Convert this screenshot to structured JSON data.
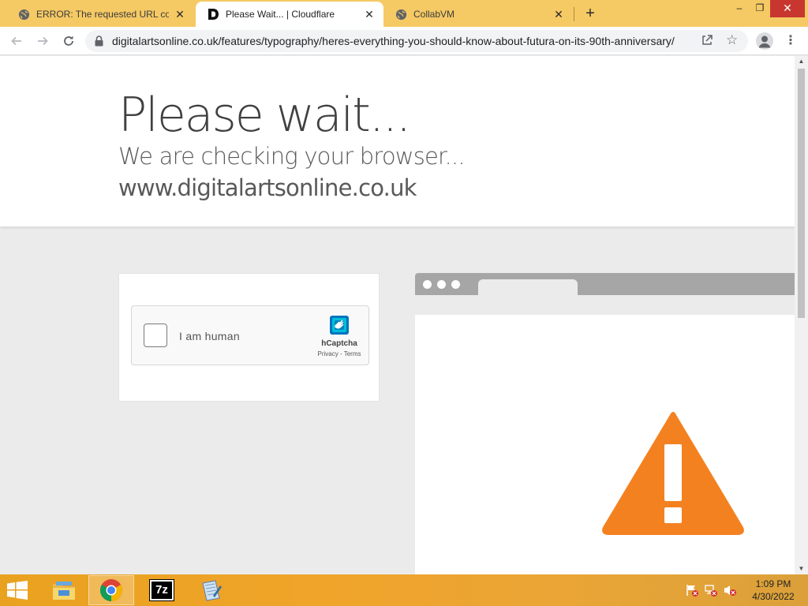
{
  "browser": {
    "tabs": [
      {
        "title": "ERROR: The requested URL could not be retrieved",
        "favicon": "globe-icon",
        "active": false
      },
      {
        "title": "Please Wait... | Cloudflare",
        "favicon": "digitalarts-d-icon",
        "active": true
      },
      {
        "title": "CollabVM",
        "favicon": "globe-icon",
        "active": false
      }
    ],
    "url": "digitalartsonline.co.uk/features/typography/heres-everything-you-should-know-about-futura-on-its-90th-anniversary/",
    "tab_close_glyph": "✕",
    "new_tab_glyph": "+",
    "window_controls": {
      "minimize": "–",
      "restore": "❐",
      "close": "✕"
    }
  },
  "page": {
    "headline": "Please wait...",
    "subline": "We are checking your browser...",
    "domain": "www.digitalartsonline.co.uk"
  },
  "captcha": {
    "label": "I am human",
    "brand": "hCaptcha",
    "links": "Privacy - Terms"
  },
  "colors": {
    "tab_strip": "#f5c964",
    "warning": "#f48120",
    "taskbar": "#f0a42a"
  },
  "taskbar": {
    "apps": [
      {
        "name": "file-explorer-icon",
        "running": false
      },
      {
        "name": "chrome-icon",
        "running": true
      },
      {
        "name": "7zip-icon",
        "running": false
      },
      {
        "name": "notepad-icon",
        "running": false
      }
    ],
    "seven_zip_label": "7z",
    "time": "1:09 PM",
    "date": "4/30/2022"
  }
}
